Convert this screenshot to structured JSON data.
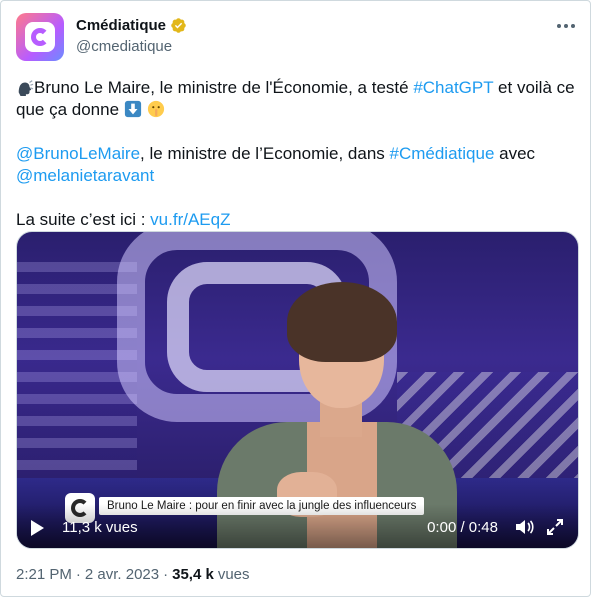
{
  "author": {
    "display_name": "Cmédiatique",
    "handle": "@cmediatique",
    "verified": true
  },
  "icons": {
    "verified": "verified-badge-icon",
    "more": "more-options-icon",
    "speaking_head": "speaking-head-emoji",
    "down_arrow": "down-arrow-emoji",
    "shushing": "shushing-face-emoji",
    "play": "play-icon",
    "volume": "volume-icon",
    "fullscreen": "fullscreen-icon"
  },
  "tweet": {
    "line1_text": "Bruno Le Maire, le ministre de l'Économie, a testé ",
    "hashtag_chatgpt": "#ChatGPT",
    "line1_after": " et voilà ce que ça donne ",
    "mention_bruno": "@BrunoLeMaire",
    "line2_text": ", le ministre de l’Economie, dans ",
    "hashtag_cmediatique": "#Cmédiatique",
    "line2_after": " avec ",
    "mention_melanie": "@melanietaravant",
    "line3_text": "La suite c’est ici : ",
    "link": "vu.fr/AEqZ"
  },
  "media": {
    "chyron": "Bruno Le Maire : pour en finir avec la jungle des influenceurs",
    "views_label": "11,3 k vues",
    "time_label": "0:00 / 0:48"
  },
  "meta": {
    "time": "2:21 PM",
    "separator": "·",
    "date": "2 avr. 2023",
    "views_count": "35,4 k",
    "views_word": "vues"
  },
  "colors": {
    "accent": "#1d9bf0",
    "text": "#0f1419",
    "secondary": "#536471",
    "verified_gold": "#e2b719"
  }
}
